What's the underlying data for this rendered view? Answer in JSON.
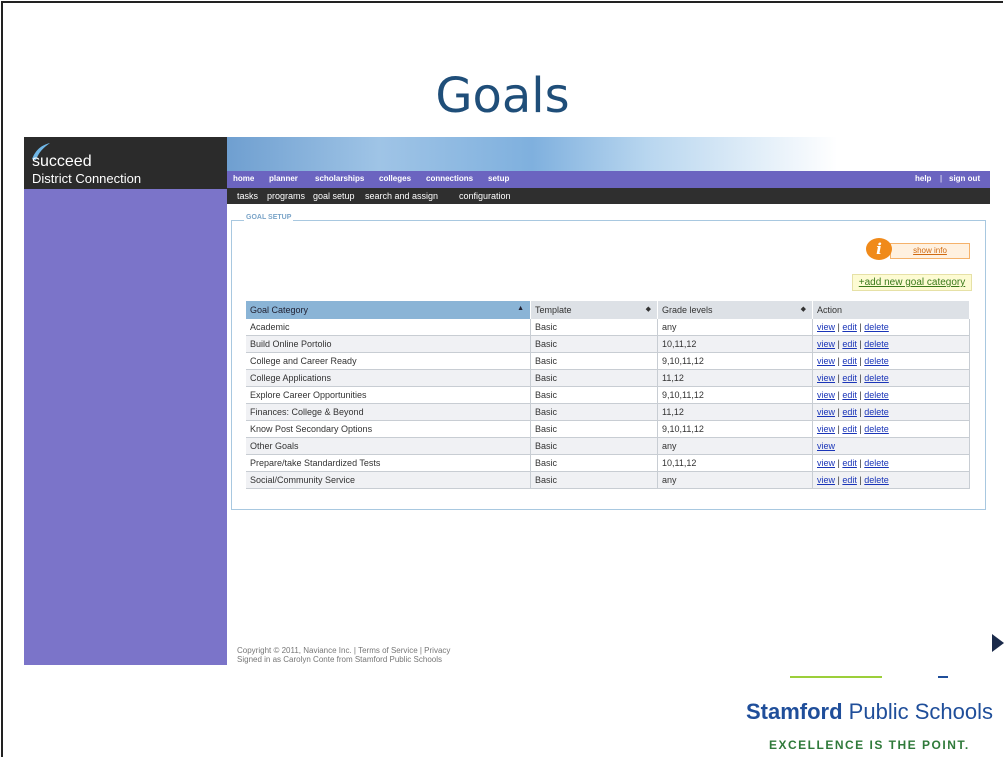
{
  "slide": {
    "title": "Goals"
  },
  "app": {
    "brand": "succeed",
    "brand_sub": "District Connection",
    "topnav": [
      "home",
      "planner",
      "scholarships",
      "colleges",
      "connections",
      "setup"
    ],
    "topnav_right": {
      "help": "help",
      "sep": "|",
      "signout": "sign out"
    },
    "subnav": [
      "tasks",
      "programs",
      "goal setup",
      "search and assign",
      "configuration"
    ]
  },
  "panel": {
    "legend": "GOAL SETUP",
    "show_info": "show info",
    "add_category": "+add new goal category"
  },
  "table": {
    "headers": [
      "Goal Category",
      "Template",
      "Grade levels",
      "Action"
    ],
    "rows": [
      {
        "category": "Academic",
        "template": "Basic",
        "grades": "any"
      },
      {
        "category": "Build Online Portolio",
        "template": "Basic",
        "grades": "10,11,12"
      },
      {
        "category": "College and Career Ready",
        "template": "Basic",
        "grades": "9,10,11,12"
      },
      {
        "category": "College Applications",
        "template": "Basic",
        "grades": "11,12"
      },
      {
        "category": "Explore Career Opportunities",
        "template": "Basic",
        "grades": "9,10,11,12"
      },
      {
        "category": "Finances: College & Beyond",
        "template": "Basic",
        "grades": "11,12"
      },
      {
        "category": "Know Post Secondary Options",
        "template": "Basic",
        "grades": "9,10,11,12"
      },
      {
        "category": "Other Goals",
        "template": "Basic",
        "grades": "any"
      },
      {
        "category": "Prepare/take Standardized Tests",
        "template": "Basic",
        "grades": "10,11,12"
      },
      {
        "category": "Social/Community Service",
        "template": "Basic",
        "grades": "any"
      }
    ],
    "actions": {
      "view": "view",
      "edit": "edit",
      "delete": "delete",
      "sep": "|"
    }
  },
  "footer": {
    "line1": "Copyright © 2011, Naviance Inc.  | Terms of Service | Privacy",
    "line2": "Signed in as Carolyn Conte from Stamford Public Schools"
  },
  "district": {
    "name_bold": "Stamford",
    "name_rest": " Public Schools",
    "tagline": "EXCELLENCE IS THE POINT."
  },
  "colors": {
    "sidebar": "#7b74c9",
    "nav": "#6b64c0",
    "subnav": "#2f2f2f",
    "link": "#1a35b8",
    "title": "#1f4e79"
  },
  "icons": [
    "succeed-logo-icon",
    "info-icon",
    "sort-asc-icon",
    "sort-icon",
    "play-icon"
  ]
}
